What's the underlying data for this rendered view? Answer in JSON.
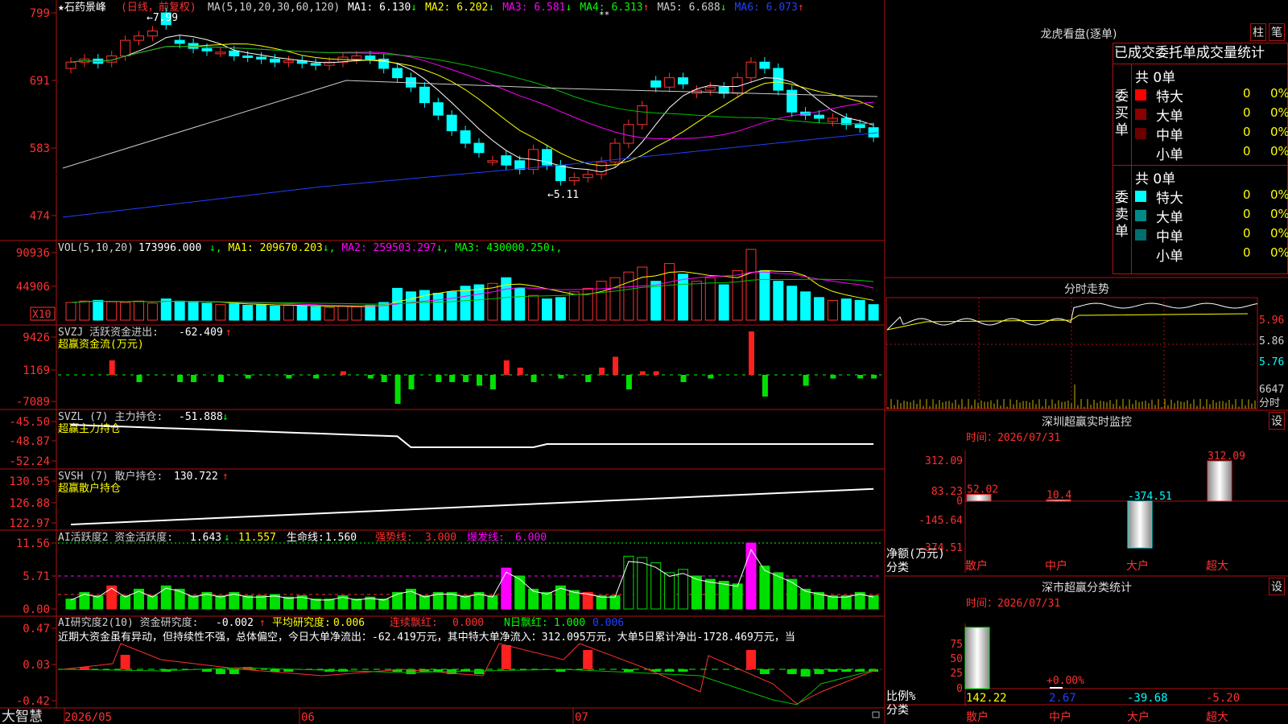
{
  "app": {
    "brand": "大智慧"
  },
  "kline": {
    "title_prefix": "★石药景峰",
    "title_suffix": "(日线，前复权)",
    "ma_header": "MA(5,10,20,30,60,120)",
    "ma_values": [
      {
        "label": "MA1:",
        "value": "6.130",
        "dir": "↓",
        "color": "#ffffff"
      },
      {
        "label": "MA2:",
        "value": "6.202",
        "dir": "↓",
        "color": "#ffff00"
      },
      {
        "label": "MA3:",
        "value": "6.581",
        "dir": "↓",
        "color": "#ff00ff"
      },
      {
        "label": "MA4:",
        "value": "6.313",
        "dir": "↑",
        "color": "#00ff00"
      },
      {
        "label": "MA5:",
        "value": "6.688",
        "dir": "↓",
        "color": "#cccccc"
      },
      {
        "label": "MA6:",
        "value": "6.073",
        "dir": "↑",
        "color": "#2040ff"
      }
    ],
    "y_ticks": [
      "799",
      "691",
      "583",
      "474"
    ],
    "high_label": "7.99",
    "low_label": "5.11",
    "markers": "**"
  },
  "volume": {
    "header": "VOL(5,10,20)",
    "value": "173996.000",
    "ma": [
      {
        "label": "MA1:",
        "value": "209670.203",
        "dir": "↓",
        "color": "#ffff00"
      },
      {
        "label": "MA2:",
        "value": "259503.297",
        "dir": "↓",
        "color": "#ff00ff"
      },
      {
        "label": "MA3:",
        "value": "430000.250",
        "dir": "↓",
        "color": "#00ff00"
      }
    ],
    "y_ticks": [
      "90936",
      "44906"
    ],
    "unit": "X10"
  },
  "svzj": {
    "header": "SVZJ  活跃资金进出:",
    "value": "-62.409",
    "dir": "↑",
    "subtitle": "超赢资金流(万元)",
    "y_ticks": [
      "9426",
      "1169",
      "-7089"
    ]
  },
  "svzl": {
    "header": "SVZL (7) 主力持仓:",
    "value": "-51.888",
    "dir": "↓",
    "subtitle": "超赢主力持仓",
    "y_ticks": [
      "-45.50",
      "-48.87",
      "-52.24"
    ]
  },
  "svsh": {
    "header": "SVSH (7) 散户持仓:",
    "value": "130.722",
    "dir": "↑",
    "subtitle": "超赢散户持仓",
    "y_ticks": [
      "130.95",
      "126.88",
      "122.97"
    ]
  },
  "ai_active": {
    "header": "AI活跃度2 资金活跃度:",
    "value": "1.643",
    "dir": "↓",
    "v2": "11.557",
    "life_label": "生命线:",
    "life_value": "1.560",
    "strong_label": "强势线:",
    "strong_value": "3.000",
    "burst_label": "爆发线:",
    "burst_value": "6.000",
    "y_ticks": [
      "11.56",
      "5.71",
      "0.00"
    ]
  },
  "ai_research": {
    "header": "AI研究度2(10) 资金研究度:",
    "value": "-0.002",
    "dir": "↑",
    "avg_label": "平均研究度:",
    "avg_value": "0.006",
    "red_label": "连续飘红:",
    "red_value": "0.000",
    "nred_label": "N日飘红:",
    "nred_value": "1.000",
    "extra": "0.006",
    "comment": "近期大资金虽有异动，但持续性不强，总体偏空，今日大单净流出：-62.419万元，其中特大单净流入：312.095万元，大单5日累计净出-1728.469万元，当",
    "y_ticks": [
      "0.47",
      "0.03",
      "-0.42"
    ]
  },
  "time_axis": [
    "2026/05",
    "06",
    "07"
  ],
  "dragon": {
    "title": "龙虎看盘(逐单)",
    "btn_bar": "柱",
    "btn_pen": "笔",
    "tab_title": "已成交委托单成交量统计",
    "buy_label": "委买单",
    "sell_label": "委卖单",
    "buy_total": "共 0单",
    "sell_total": "共 0单",
    "buy_rows": [
      {
        "name": "特大",
        "count": "0",
        "pct": "0%",
        "color": "#ff0000"
      },
      {
        "name": "大单",
        "count": "0",
        "pct": "0%",
        "color": "#8b0000"
      },
      {
        "name": "中单",
        "count": "0",
        "pct": "0%",
        "color": "#6a0000"
      },
      {
        "name": "小单",
        "count": "0",
        "pct": "0%",
        "color": ""
      }
    ],
    "sell_rows": [
      {
        "name": "特大",
        "count": "0",
        "pct": "0%",
        "color": "#00ffff"
      },
      {
        "name": "大单",
        "count": "0",
        "pct": "0%",
        "color": "#008b8b"
      },
      {
        "name": "中单",
        "count": "0",
        "pct": "0%",
        "color": "#006f6f"
      },
      {
        "name": "小单",
        "count": "0",
        "pct": "0%",
        "color": ""
      }
    ]
  },
  "intraday": {
    "title": "分时走势",
    "price_ticks": [
      "5.96",
      "5.86",
      "5.76"
    ],
    "vol_tick": "6647",
    "vol_unit": "分时"
  },
  "monitor": {
    "title": "深圳超赢实时监控",
    "settings": "设",
    "time_label": "时间：2026/07/31",
    "y_ticks": [
      "312.09",
      "83.23",
      "0",
      "-145.64",
      "-374.51"
    ],
    "y_caption": "净额(万元)",
    "x_caption": "分类",
    "categories": [
      "散户",
      "中户",
      "大户",
      "超大"
    ],
    "values": [
      "52.02",
      "10.4",
      "-374.51",
      "312.09"
    ]
  },
  "classify": {
    "title": "深市超赢分类统计",
    "settings": "设",
    "time_label": "时间：2026/07/31",
    "y_ticks": [
      "75",
      "50",
      "25",
      "0"
    ],
    "y_caption": "比例%",
    "x_caption": "分类",
    "categories": [
      "散户",
      "中户",
      "大户",
      "超大"
    ],
    "values": [
      "142.22",
      "2.67",
      "-39.68",
      "-5.20"
    ],
    "note": "+0.00%"
  }
}
